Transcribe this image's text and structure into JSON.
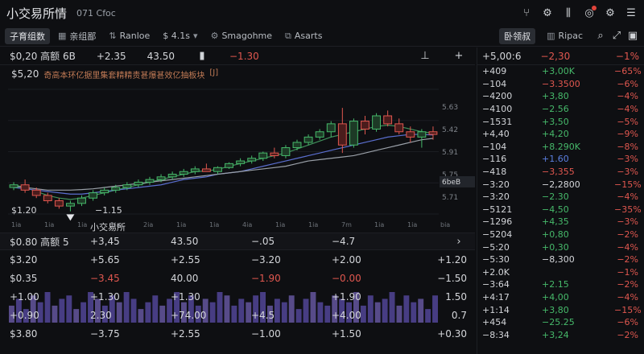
{
  "app": {
    "title": "小交易所情",
    "subtitle": "071 Cfoc"
  },
  "toolbar": {
    "items": [
      {
        "label": "子育组数",
        "icon": "",
        "active": true
      },
      {
        "label": "亲组鄙",
        "icon": "grid-icon",
        "active": false
      },
      {
        "label": "Ranloe",
        "icon": "chart-icon",
        "active": false
      },
      {
        "label": "$ 4.1s",
        "icon": "",
        "active": false,
        "dropdown": true
      },
      {
        "label": "Smagohme",
        "icon": "gear-icon",
        "active": false
      },
      {
        "label": "Asarts",
        "icon": "alert-icon",
        "active": false
      }
    ]
  },
  "chart": {
    "header": {
      "name": "$0,20 高额 6B",
      "change": "+2.35",
      "price": "43.50",
      "delta": "−1.30"
    },
    "sub_price": "$5,20",
    "sub_desc": "奇高本环亿据里集套精精责甚爆甚效亿抽板块",
    "sub_tag": "[J]",
    "bottom_price": "$1.20",
    "bottom_change": "−1.15",
    "exchange_label": "小交易所",
    "badge": "6beB",
    "x_ticks": [
      "1ia",
      "1ia",
      "1ia",
      "1ia",
      "2ia",
      "1ia",
      "1ia",
      "4ia",
      "1ia",
      "1ia",
      "7m",
      "1ia",
      "1ia",
      "bia"
    ],
    "y_ticks": [
      "5.63",
      "5.42",
      "5.91",
      "5.75",
      "5.71"
    ]
  },
  "chart_data": {
    "type": "line",
    "title": "",
    "xlabel": "",
    "ylabel": "",
    "ylim": [
      1.0,
      5.7
    ],
    "candles": [
      [
        2.0,
        2.2,
        1.9,
        2.1
      ],
      [
        2.1,
        2.3,
        1.8,
        1.9
      ],
      [
        1.9,
        2.0,
        1.6,
        1.7
      ],
      [
        1.7,
        1.8,
        1.4,
        1.5
      ],
      [
        1.5,
        1.6,
        1.2,
        1.3
      ],
      [
        1.3,
        1.5,
        1.1,
        1.4
      ],
      [
        1.4,
        1.7,
        1.3,
        1.6
      ],
      [
        1.6,
        1.9,
        1.5,
        1.8
      ],
      [
        1.8,
        2.0,
        1.7,
        1.9
      ],
      [
        1.9,
        2.1,
        1.8,
        2.0
      ],
      [
        2.0,
        2.2,
        1.9,
        2.1
      ],
      [
        2.1,
        2.3,
        2.0,
        2.2
      ],
      [
        2.2,
        2.4,
        2.1,
        2.3
      ],
      [
        2.3,
        2.5,
        2.2,
        2.4
      ],
      [
        2.4,
        2.6,
        2.3,
        2.5
      ],
      [
        2.5,
        2.7,
        2.4,
        2.6
      ],
      [
        2.6,
        2.8,
        2.5,
        2.7
      ],
      [
        2.7,
        2.9,
        2.6,
        2.6
      ],
      [
        2.6,
        2.8,
        2.5,
        2.75
      ],
      [
        2.75,
        2.95,
        2.7,
        2.9
      ],
      [
        2.9,
        3.1,
        2.8,
        3.0
      ],
      [
        3.0,
        3.2,
        2.9,
        3.1
      ],
      [
        3.1,
        3.35,
        3.0,
        3.3
      ],
      [
        3.3,
        3.5,
        3.1,
        3.2
      ],
      [
        3.2,
        3.6,
        3.1,
        3.5
      ],
      [
        3.5,
        3.8,
        3.4,
        3.7
      ],
      [
        3.7,
        4.0,
        3.6,
        3.9
      ],
      [
        3.9,
        4.2,
        3.8,
        4.1
      ],
      [
        4.1,
        4.5,
        3.9,
        4.4
      ],
      [
        4.4,
        5.0,
        3.3,
        3.6
      ],
      [
        3.6,
        4.6,
        3.5,
        4.5
      ],
      [
        4.5,
        4.7,
        4.0,
        4.2
      ],
      [
        4.2,
        4.8,
        4.1,
        4.7
      ],
      [
        4.7,
        4.9,
        4.3,
        4.4
      ],
      [
        4.4,
        4.6,
        4.0,
        4.1
      ],
      [
        4.1,
        4.3,
        3.7,
        3.9
      ],
      [
        3.9,
        4.2,
        3.5,
        4.1
      ],
      [
        4.1,
        4.3,
        3.8,
        4.0
      ]
    ],
    "series": [
      {
        "values": [
          2.1,
          2.0,
          1.85,
          1.7,
          1.6,
          1.55,
          1.6,
          1.7,
          1.8,
          1.9,
          2.0,
          2.1,
          2.2,
          2.3,
          2.4,
          2.5,
          2.6,
          2.62,
          2.68,
          2.8,
          2.9,
          3.0,
          3.1,
          3.2,
          3.3,
          3.45,
          3.6,
          3.75,
          3.9,
          4.0,
          4.1,
          4.2,
          4.3,
          4.35,
          4.3,
          4.2,
          4.1,
          4.05
        ]
      },
      {
        "values": [
          2.0,
          1.95,
          1.9,
          1.85,
          1.8,
          1.75,
          1.75,
          1.8,
          1.85,
          1.9,
          1.95,
          2.0,
          2.05,
          2.1,
          2.2,
          2.3,
          2.35,
          2.4,
          2.5,
          2.55,
          2.6,
          2.7,
          2.8,
          2.9,
          3.0,
          3.1,
          3.2,
          3.3,
          3.4,
          3.5,
          3.6,
          3.7,
          3.8,
          3.9,
          3.95,
          4.0,
          4.0,
          3.98
        ]
      },
      {
        "values": [
          2.05,
          2.0,
          1.95,
          1.9,
          1.9,
          1.9,
          1.92,
          1.95,
          2.0,
          2.05,
          2.1,
          2.15,
          2.2,
          2.25,
          2.3,
          2.35,
          2.4,
          2.45,
          2.5,
          2.55,
          2.6,
          2.65,
          2.7,
          2.75,
          2.8,
          2.9,
          3.0,
          3.05,
          3.1,
          3.15,
          3.2,
          3.3,
          3.4,
          3.5,
          3.6,
          3.7,
          3.8,
          3.85
        ]
      }
    ]
  },
  "lower": {
    "header": [
      "$0.80 高额 5",
      "+3,45",
      "43.50",
      "−.05",
      "−4.7"
    ],
    "rows": [
      [
        {
          "v": "$3.20",
          "c": "neu"
        },
        {
          "v": "+5.65",
          "c": "neu"
        },
        {
          "v": "+2.55",
          "c": "neu"
        },
        {
          "v": "−3.20",
          "c": "neu"
        },
        {
          "v": "+2.00",
          "c": "neu"
        },
        {
          "v": "+1.20",
          "c": "neu"
        }
      ],
      [
        {
          "v": "$0.35",
          "c": "neu"
        },
        {
          "v": "−3.45",
          "c": "neg"
        },
        {
          "v": "40.00",
          "c": "neu"
        },
        {
          "v": "−1.90",
          "c": "neg"
        },
        {
          "v": "−0.00",
          "c": "neg"
        },
        {
          "v": "−1.50",
          "c": "neu"
        }
      ],
      [
        {
          "v": "+1.00",
          "c": "neu"
        },
        {
          "v": "+1.30",
          "c": "neu"
        },
        {
          "v": "+1.30",
          "c": "neu"
        },
        {
          "v": "",
          "c": "neu"
        },
        {
          "v": "+1.90",
          "c": "neu"
        },
        {
          "v": "1.50",
          "c": "neu"
        }
      ],
      [
        {
          "v": "+0.90",
          "c": "neu"
        },
        {
          "v": "2.30",
          "c": "neu"
        },
        {
          "v": "+74.00",
          "c": "neu"
        },
        {
          "v": "+4.5",
          "c": "neu"
        },
        {
          "v": "+4.00",
          "c": "neu"
        },
        {
          "v": "0.7",
          "c": "neu"
        }
      ],
      [
        {
          "v": "$3.80",
          "c": "neu"
        },
        {
          "v": "−3.75",
          "c": "neu"
        },
        {
          "v": "+2.55",
          "c": "neu"
        },
        {
          "v": "−1.00",
          "c": "neu"
        },
        {
          "v": "+1.50",
          "c": "neu"
        },
        {
          "v": "+0.30",
          "c": "neu"
        }
      ]
    ],
    "volume_values": [
      5,
      7,
      4,
      8,
      6,
      9,
      5,
      7,
      8,
      4,
      6,
      9,
      7,
      5,
      8,
      6,
      9,
      7,
      4,
      6,
      8,
      5,
      7,
      9,
      6,
      8,
      5,
      7,
      6,
      9,
      8,
      5,
      7,
      6,
      8,
      9,
      5,
      7,
      6,
      8,
      4,
      7,
      9,
      6,
      5,
      8,
      7,
      6,
      9,
      5,
      8,
      6,
      7,
      9,
      5,
      8,
      6,
      7,
      4,
      8
    ]
  },
  "right": {
    "tabs": [
      "卧领叔",
      "Ripac"
    ],
    "header": {
      "a": "+5,00:6",
      "b": "−2,30",
      "c": "−1%"
    },
    "rows": [
      {
        "a": "+409",
        "b": "+3,00K",
        "bc": "pos",
        "c": "−65%"
      },
      {
        "a": "−104",
        "b": "−3.3500",
        "bc": "neg",
        "c": "−6%"
      },
      {
        "a": "−4200",
        "b": "+3,80",
        "bc": "pos",
        "c": "−4%"
      },
      {
        "a": "−4100",
        "b": "−2.56",
        "bc": "pos",
        "c": "−4%"
      },
      {
        "a": "−1531",
        "b": "+3,50",
        "bc": "pos",
        "c": "−5%"
      },
      {
        "a": "+4,40",
        "b": "+4,20",
        "bc": "pos",
        "c": "−9%"
      },
      {
        "a": "−104",
        "b": "+8.290K",
        "bc": "pos",
        "c": "−8%"
      },
      {
        "a": "−116",
        "b": "+1.60",
        "bc": "blue",
        "c": "−3%"
      },
      {
        "a": "−418",
        "b": "−3,355",
        "bc": "neg",
        "c": "−3%"
      },
      {
        "a": "−3:20",
        "b": "−2,2800",
        "bc": "neu",
        "c": "−15%"
      },
      {
        "a": "−3:20",
        "b": "−2.30",
        "bc": "pos",
        "c": "−4%"
      },
      {
        "a": "−5121",
        "b": "−4,50",
        "bc": "pos",
        "c": "−35%"
      },
      {
        "a": "−1296",
        "b": "+4,35",
        "bc": "pos",
        "c": "−3%"
      },
      {
        "a": "−5204",
        "b": "+0,80",
        "bc": "pos",
        "c": "−2%"
      },
      {
        "a": "−5:20",
        "b": "+0,30",
        "bc": "pos",
        "c": "−4%"
      },
      {
        "a": "−5:30",
        "b": "−8,300",
        "bc": "neu",
        "c": "−2%"
      },
      {
        "a": "+2.0K",
        "b": "",
        "bc": "neu",
        "c": "−1%"
      },
      {
        "a": "−3:64",
        "b": "+2.15",
        "bc": "pos",
        "c": "−2%"
      },
      {
        "a": "+4:17",
        "b": "+4,00",
        "bc": "pos",
        "c": "−4%"
      },
      {
        "a": "+1:14",
        "b": "+3,80",
        "bc": "pos",
        "c": "−15%"
      },
      {
        "a": "+454",
        "b": "−25.25",
        "bc": "pos",
        "c": "−6%"
      },
      {
        "a": "−8:34",
        "b": "+3,24",
        "bc": "pos",
        "c": "−2%"
      }
    ]
  }
}
